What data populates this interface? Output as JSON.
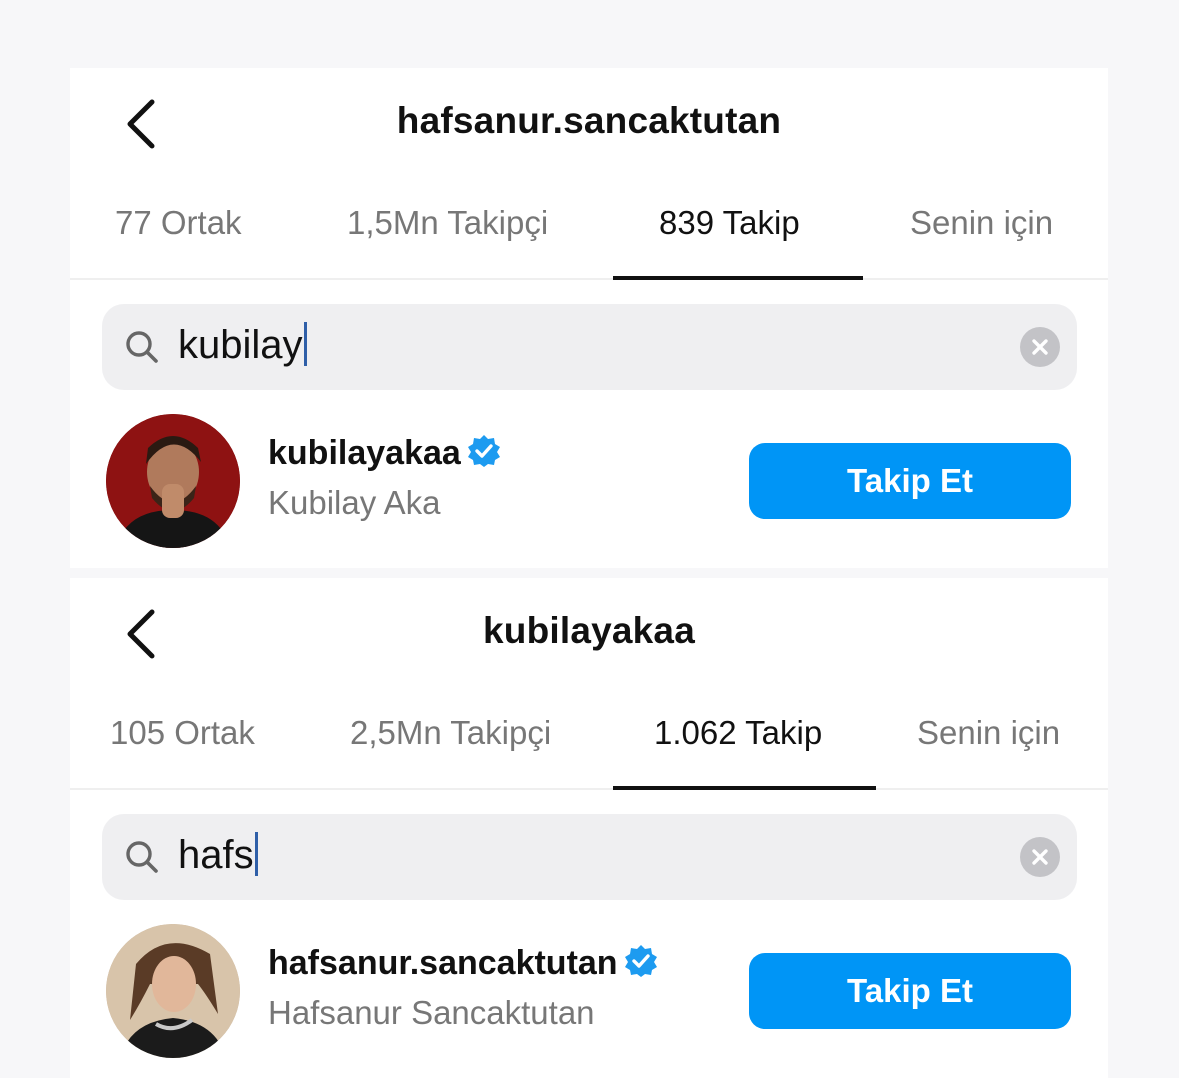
{
  "panels": [
    {
      "title": "hafsanur.sancaktutan",
      "tabs": [
        {
          "label": "77 Ortak",
          "active": false
        },
        {
          "label": "1,5Mn Takipçi",
          "active": false
        },
        {
          "label": "839 Takip",
          "active": true
        },
        {
          "label": "Senin için",
          "active": false
        }
      ],
      "search": {
        "query": "kubilay"
      },
      "result": {
        "username": "kubilayakaa",
        "verified": true,
        "full_name": "Kubilay Aka",
        "button_label": "Takip Et"
      }
    },
    {
      "title": "kubilayakaa",
      "tabs": [
        {
          "label": "105 Ortak",
          "active": false
        },
        {
          "label": "2,5Mn Takipçi",
          "active": false
        },
        {
          "label": "1.062 Takip",
          "active": true
        },
        {
          "label": "Senin için",
          "active": false
        }
      ],
      "search": {
        "query": "hafs"
      },
      "result": {
        "username": "hafsanur.sancaktutan",
        "verified": true,
        "full_name": "Hafsanur Sancaktutan",
        "button_label": "Takip Et"
      }
    }
  ],
  "icons": {
    "back": "chevron-left-icon",
    "search": "search-icon",
    "clear": "clear-icon",
    "verified": "verified-badge-icon"
  },
  "colors": {
    "accent": "#0095f6",
    "verified": "#1d9bf0",
    "search_bg": "#efeff1",
    "muted_text": "#777777"
  }
}
